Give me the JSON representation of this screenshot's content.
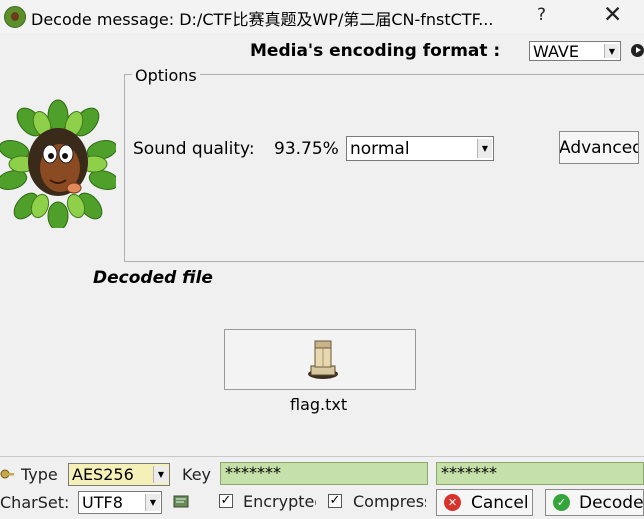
{
  "window": {
    "title": "Decode message: D:/CTF比赛真题及WP/第二届CN-fnstCTF...",
    "help": "?",
    "close": "✕"
  },
  "header": {
    "media_label": "Media's encoding format :",
    "media_format": "WAVE"
  },
  "options": {
    "legend": "Options",
    "sound_quality_label": "Sound quality:",
    "sound_quality_pct": "93.75%",
    "sound_quality_value": "normal",
    "advanced_label": "Advanced"
  },
  "decoded": {
    "label": "Decoded file",
    "file_name": "flag.txt"
  },
  "bottom": {
    "type_label": "Type",
    "type_value": "AES256",
    "key_label": "Key",
    "key_value": "*******",
    "key_confirm_value": "*******",
    "charset_label": "CharSet:",
    "charset_value": "UTF8",
    "encrypted_label": "Encrypted",
    "compressed_label": "Compressed",
    "encrypted_checked": "✓",
    "compressed_checked": "✓",
    "cancel_label": "Cancel",
    "decode_label": "Decode"
  },
  "colors": {
    "key_field_bg": "#c6e0a9",
    "type_select_bg": "#f5f0b8",
    "cancel_icon": "#d8332b",
    "decode_icon": "#35a53a"
  },
  "icons": [
    "app-icon",
    "help-icon",
    "close-icon",
    "play-icon",
    "mascot-icon",
    "file-box-icon",
    "type-key-icon",
    "charset-icon",
    "cancel-icon",
    "decode-check-icon"
  ]
}
